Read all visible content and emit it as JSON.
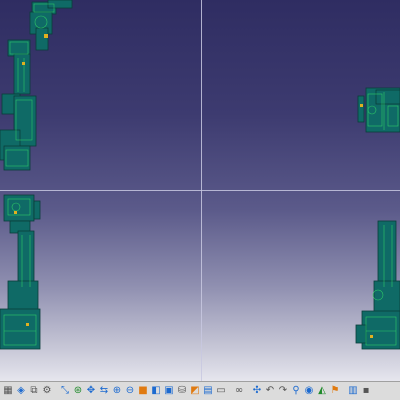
{
  "window": {
    "layout": "four-viewport CAD view",
    "background_gradient": [
      "#2f2d62",
      "#e6e6ee"
    ],
    "model_color": "#0f6a66",
    "model_edge_color": "#33dd66"
  },
  "viewports": [
    {
      "name": "top-left-view",
      "content": "robot-arm-model"
    },
    {
      "name": "top-right-view",
      "content": "robot-arm-model"
    },
    {
      "name": "bottom-left-view",
      "content": "robot-arm-model"
    },
    {
      "name": "bottom-right-view",
      "content": "robot-arm-model"
    }
  ],
  "toolbar": {
    "groups": [
      [
        "grid-icon",
        "render-style-icon",
        "layers-icon",
        "gear-icon"
      ],
      [
        "pan-icon",
        "rotate-icon",
        "move-icon",
        "fly-icon",
        "zoom-in-icon",
        "zoom-out-icon",
        "normal-view-icon",
        "cube-view-icon",
        "multi-view-icon",
        "shading-icon",
        "hide-show-icon",
        "swap-icon",
        "print-icon"
      ],
      [
        "glasses-icon"
      ],
      [
        "compass-icon",
        "undo-icon",
        "redo-icon",
        "search-icon",
        "eye-icon",
        "measure-icon",
        "flag-icon"
      ],
      [
        "snapshot-icon",
        "more-icon"
      ]
    ]
  }
}
